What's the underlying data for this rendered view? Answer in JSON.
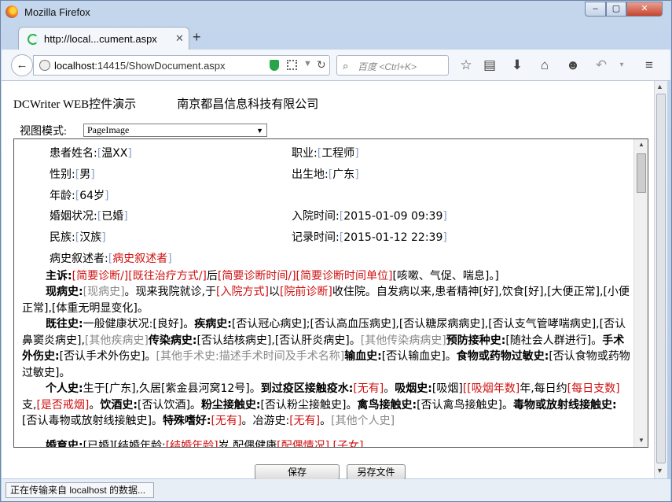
{
  "window": {
    "title": "Mozilla Firefox",
    "min": "–",
    "max": "▢",
    "close": "✕"
  },
  "tab": {
    "label": "http://local...cument.aspx",
    "close": "✕",
    "new": "+"
  },
  "nav": {
    "back": "←",
    "url_host": "localhost",
    "url_rest": ":14415/ShowDocument.aspx",
    "search_placeholder": "百度 <Ctrl+K>",
    "reload": "↻"
  },
  "toolbar_icons": [
    "star-icon",
    "reading-list-icon",
    "download-icon",
    "home-icon",
    "chat-icon",
    "undo-icon",
    "menu-icon"
  ],
  "page": {
    "app_title": "DCWriter WEB控件演示",
    "company": "南京都昌信息科技有限公司",
    "mode_label": "视图模式:",
    "mode_value": "PageImage"
  },
  "patient": {
    "name_label": "患者姓名:",
    "name": "温XX",
    "job_label": "职业:",
    "job": "工程师",
    "sex_label": "性别:",
    "sex": "男",
    "birthplace_label": "出生地:",
    "birthplace": "广东",
    "age_label": "年龄:",
    "age": "64岁",
    "marital_label": "婚姻状况:",
    "marital": "已婚",
    "admit_label": "入院时间:",
    "admit": "2015-01-09 09:39",
    "ethnic_label": "民族:",
    "ethnic": "汉族",
    "record_label": "记录时间:",
    "record": "2015-01-12 22:39",
    "narrator_label": "病史叙述者:",
    "narrator": "病史叙述者"
  },
  "record": {
    "p1_a": "主诉:",
    "p1_b": "[简要诊断/]",
    "p1_c": "[既往治疗方式/]",
    "p1_d": "后",
    "p1_e": "[简要诊断时间/]",
    "p1_f": "[简要诊断时间单位]",
    "p1_g": "[咳嗽、气促、喘息]。]",
    "p2_a": "现病史:",
    "p2_b": "[现病史]",
    "p2_c": "。现来我院就诊,于",
    "p2_d": "[入院方式]",
    "p2_e": "以",
    "p2_f": "[院前诊断]",
    "p2_g": "收住院。自发病以来,患者精神[好],饮食[好],[大便正常],[小便正常],[体重无明显变化]。",
    "p3_a": "既往史:",
    "p3_b": "一般健康状况:[良好]。",
    "p3_c": "疾病史:",
    "p3_d": "[否认冠心病史];[否认高血压病史],[否认糖尿病病史],[否认支气管哮喘病史],[否认鼻窦炎病史],",
    "p3_e": "[其他疾病史]",
    "p3_f": "传染病史:",
    "p3_g": "[否认结核病史],[否认肝炎病史]。",
    "p3_h": "[其他传染病病史]",
    "p3_i": "预防接种史:",
    "p3_j": "[随社会人群进行]。",
    "p3_k": "手术外伤史:",
    "p3_l": "[否认手术外伤史]。",
    "p3_m": "[其他手术史:描述手术时间及手术名称]",
    "p3_n": "输血史:",
    "p3_o": "[否认输血史]。",
    "p3_p": "食物或药物过敏史:",
    "p3_q": "[否认食物或药物过敏史]。",
    "p4_a": "个人史:",
    "p4_b": "生于[广东],久居[紫金县河窝12号]。",
    "p4_c": "到过疫区接触疫水:",
    "p4_d": "[无有]",
    "p4_e": "。",
    "p4_f": "吸烟史:",
    "p4_g": "[吸烟]",
    "p4_h": "[[吸烟年数]",
    "p4_i": "年,每日约",
    "p4_j": "[每日支数]",
    "p4_k": "支,",
    "p4_l": "[是否戒烟]",
    "p4_m": "。",
    "p4_n": "饮酒史:",
    "p4_o": "[否认饮酒]。",
    "p4_p": "粉尘接触史:",
    "p4_q": "[否认粉尘接触史]。",
    "p4_r": "禽鸟接触史:",
    "p4_s": "[否认禽鸟接触史]。",
    "p4_t": "毒物或放射线接触史:",
    "p4_u": "[否认毒物或放射线接触史]。",
    "p4_v": "特殊嗜好:",
    "p4_w": "[无有]",
    "p4_x": "。冶游史:",
    "p4_y": "[无有]",
    "p4_z": "。",
    "p4_aa": "[其他个人史]",
    "p5_a": "婚育史:",
    "p5_b": "[已婚][结婚年龄:",
    "p5_c": "[结婚年龄]",
    "p5_d": "岁,配偶健康",
    "p5_e": "[配偶情况]",
    "p5_f": ",",
    "p5_g": "[子女]"
  },
  "buttons": {
    "save": "保存",
    "save_as": "另存文件"
  },
  "status": {
    "text": "正在传输来自 localhost 的数据..."
  }
}
